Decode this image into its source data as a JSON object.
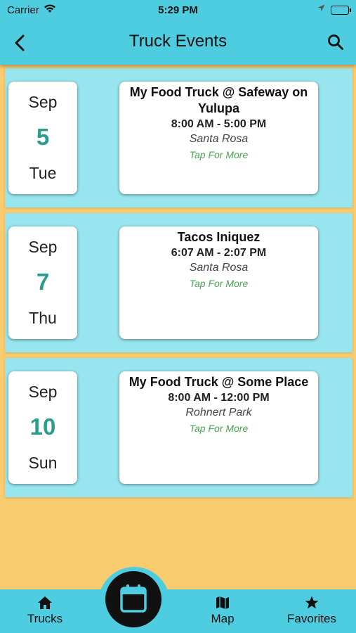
{
  "status_bar": {
    "carrier": "Carrier",
    "time": "5:29 PM",
    "wifi_icon": "wifi-icon",
    "location_icon": "location-arrow-icon",
    "battery_icon": "battery-full-icon"
  },
  "nav": {
    "title": "Truck Events",
    "back_icon": "chevron-left-icon",
    "search_icon": "search-icon"
  },
  "events": [
    {
      "month": "Sep",
      "day": "5",
      "weekday": "Tue",
      "name": "My Food Truck @ Safeway on Yulupa",
      "hours": "8:00 AM - 5:00 PM",
      "city": "Santa Rosa",
      "more": "Tap For More"
    },
    {
      "month": "Sep",
      "day": "7",
      "weekday": "Thu",
      "name": "Tacos Iniquez",
      "hours": "6:07 AM - 2:07 PM",
      "city": "Santa Rosa",
      "more": "Tap For More"
    },
    {
      "month": "Sep",
      "day": "10",
      "weekday": "Sun",
      "name": "My Food Truck @ Some Place",
      "hours": "8:00 AM - 12:00 PM",
      "city": "Rohnert Park",
      "more": "Tap For More"
    }
  ],
  "tab_bar": {
    "trucks": {
      "label": "Trucks",
      "icon": "home-icon"
    },
    "calendar": {
      "icon": "calendar-icon"
    },
    "map": {
      "label": "Map",
      "icon": "map-icon"
    },
    "favorites": {
      "label": "Favorites",
      "icon": "star-icon"
    }
  },
  "colors": {
    "accent": "#4fcde0",
    "row_background": "#97e5ef",
    "page_background": "#f9cb6f",
    "day_number": "#2a9d8f",
    "tap_more": "#4aa552"
  }
}
